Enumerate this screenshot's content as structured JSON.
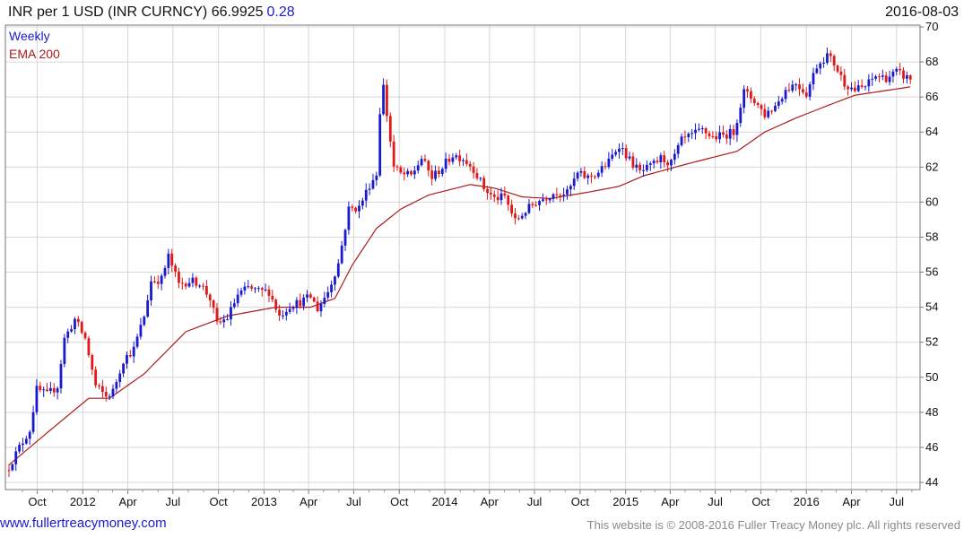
{
  "header": {
    "title": "INR per 1 USD (INR CURNCY) 66.9925",
    "change": "0.28",
    "date": "2016-08-03"
  },
  "chart_data": {
    "type": "candlestick",
    "frequency_label": "Weekly",
    "indicator_label": "EMA 200",
    "ylim": [
      44,
      70
    ],
    "y_ticks": [
      44,
      46,
      48,
      50,
      52,
      54,
      56,
      58,
      60,
      62,
      64,
      66,
      68,
      70
    ],
    "x_ticks": [
      {
        "label": "Oct",
        "date": "2011-10-01"
      },
      {
        "label": "2012",
        "date": "2012-01-01"
      },
      {
        "label": "Apr",
        "date": "2012-04-01"
      },
      {
        "label": "Jul",
        "date": "2012-07-01"
      },
      {
        "label": "Oct",
        "date": "2012-10-01"
      },
      {
        "label": "2013",
        "date": "2013-01-01"
      },
      {
        "label": "Apr",
        "date": "2013-04-01"
      },
      {
        "label": "Jul",
        "date": "2013-07-01"
      },
      {
        "label": "Oct",
        "date": "2013-10-01"
      },
      {
        "label": "2014",
        "date": "2014-01-01"
      },
      {
        "label": "Apr",
        "date": "2014-04-01"
      },
      {
        "label": "Jul",
        "date": "2014-07-01"
      },
      {
        "label": "Oct",
        "date": "2014-10-01"
      },
      {
        "label": "2015",
        "date": "2015-01-01"
      },
      {
        "label": "Apr",
        "date": "2015-04-01"
      },
      {
        "label": "Jul",
        "date": "2015-07-01"
      },
      {
        "label": "Oct",
        "date": "2015-10-01"
      },
      {
        "label": "2016",
        "date": "2016-01-01"
      },
      {
        "label": "Apr",
        "date": "2016-04-01"
      },
      {
        "label": "Jul",
        "date": "2016-07-01"
      }
    ],
    "close_path": [
      [
        "2011-08-05",
        44.9
      ],
      [
        "2011-08-26",
        46.0
      ],
      [
        "2011-09-16",
        47.0
      ],
      [
        "2011-09-30",
        49.3
      ],
      [
        "2011-10-21",
        49.0
      ],
      [
        "2011-11-11",
        49.5
      ],
      [
        "2011-11-25",
        52.2
      ],
      [
        "2011-12-16",
        53.3
      ],
      [
        "2012-01-06",
        52.2
      ],
      [
        "2012-01-27",
        49.5
      ],
      [
        "2012-02-17",
        48.9
      ],
      [
        "2012-03-02",
        49.2
      ],
      [
        "2012-03-23",
        51.0
      ],
      [
        "2012-04-13",
        51.6
      ],
      [
        "2012-05-04",
        53.5
      ],
      [
        "2012-05-18",
        55.5
      ],
      [
        "2012-06-08",
        55.6
      ],
      [
        "2012-06-22",
        56.9
      ],
      [
        "2012-07-13",
        55.3
      ],
      [
        "2012-08-03",
        55.5
      ],
      [
        "2012-08-24",
        55.4
      ],
      [
        "2012-09-14",
        54.5
      ],
      [
        "2012-09-28",
        53.0
      ],
      [
        "2012-10-19",
        53.4
      ],
      [
        "2012-11-09",
        54.7
      ],
      [
        "2012-11-30",
        55.1
      ],
      [
        "2012-12-21",
        54.9
      ],
      [
        "2013-01-11",
        54.9
      ],
      [
        "2013-02-01",
        53.5
      ],
      [
        "2013-02-22",
        54.1
      ],
      [
        "2013-03-15",
        54.3
      ],
      [
        "2013-04-05",
        54.6
      ],
      [
        "2013-04-19",
        53.9
      ],
      [
        "2013-05-10",
        54.9
      ],
      [
        "2013-05-31",
        56.5
      ],
      [
        "2013-06-21",
        59.6
      ],
      [
        "2013-07-12",
        59.7
      ],
      [
        "2013-08-02",
        61.0
      ],
      [
        "2013-08-16",
        61.6
      ],
      [
        "2013-08-23",
        65.2
      ],
      [
        "2013-08-30",
        66.6
      ],
      [
        "2013-09-06",
        65.0
      ],
      [
        "2013-09-20",
        62.0
      ],
      [
        "2013-10-04",
        61.6
      ],
      [
        "2013-10-25",
        61.5
      ],
      [
        "2013-11-15",
        62.5
      ],
      [
        "2013-12-06",
        61.4
      ],
      [
        "2013-12-27",
        62.0
      ],
      [
        "2014-01-17",
        62.7
      ],
      [
        "2014-02-07",
        62.5
      ],
      [
        "2014-02-28",
        61.9
      ],
      [
        "2014-03-21",
        60.8
      ],
      [
        "2014-04-11",
        60.2
      ],
      [
        "2014-05-02",
        60.3
      ],
      [
        "2014-05-23",
        58.9
      ],
      [
        "2014-06-13",
        59.5
      ],
      [
        "2014-07-04",
        60.0
      ],
      [
        "2014-07-25",
        60.3
      ],
      [
        "2014-08-15",
        60.6
      ],
      [
        "2014-09-05",
        60.5
      ],
      [
        "2014-09-26",
        61.6
      ],
      [
        "2014-10-17",
        61.4
      ],
      [
        "2014-11-07",
        61.7
      ],
      [
        "2014-11-28",
        62.3
      ],
      [
        "2014-12-19",
        63.3
      ],
      [
        "2015-01-09",
        62.4
      ],
      [
        "2015-01-30",
        61.7
      ],
      [
        "2015-02-20",
        62.0
      ],
      [
        "2015-03-13",
        62.5
      ],
      [
        "2015-04-03",
        62.2
      ],
      [
        "2015-04-24",
        63.5
      ],
      [
        "2015-05-15",
        63.8
      ],
      [
        "2015-06-05",
        64.1
      ],
      [
        "2015-06-26",
        63.7
      ],
      [
        "2015-07-17",
        63.8
      ],
      [
        "2015-08-07",
        64.0
      ],
      [
        "2015-08-28",
        66.3
      ],
      [
        "2015-09-18",
        65.8
      ],
      [
        "2015-10-09",
        65.0
      ],
      [
        "2015-10-30",
        65.5
      ],
      [
        "2015-11-20",
        66.4
      ],
      [
        "2015-12-11",
        66.8
      ],
      [
        "2016-01-01",
        66.2
      ],
      [
        "2016-01-22",
        67.8
      ],
      [
        "2016-02-12",
        68.4
      ],
      [
        "2016-02-26",
        67.9
      ],
      [
        "2016-03-18",
        66.8
      ],
      [
        "2016-04-08",
        66.4
      ],
      [
        "2016-04-29",
        66.6
      ],
      [
        "2016-05-20",
        67.2
      ],
      [
        "2016-06-10",
        67.1
      ],
      [
        "2016-07-01",
        67.4
      ],
      [
        "2016-07-22",
        67.1
      ],
      [
        "2016-08-03",
        66.99
      ]
    ],
    "ema_path": [
      [
        "2011-08-05",
        45.0
      ],
      [
        "2011-10-28",
        47.0
      ],
      [
        "2012-01-13",
        48.8
      ],
      [
        "2012-02-24",
        48.8
      ],
      [
        "2012-05-04",
        50.2
      ],
      [
        "2012-07-27",
        52.6
      ],
      [
        "2012-10-19",
        53.5
      ],
      [
        "2013-01-25",
        54.0
      ],
      [
        "2013-04-05",
        54.0
      ],
      [
        "2013-05-24",
        54.5
      ],
      [
        "2013-06-28",
        56.4
      ],
      [
        "2013-08-16",
        58.5
      ],
      [
        "2013-10-04",
        59.6
      ],
      [
        "2013-11-29",
        60.4
      ],
      [
        "2014-02-21",
        61.0
      ],
      [
        "2014-04-11",
        60.8
      ],
      [
        "2014-06-06",
        60.3
      ],
      [
        "2014-08-01",
        60.2
      ],
      [
        "2014-10-24",
        60.6
      ],
      [
        "2014-12-19",
        60.9
      ],
      [
        "2015-02-06",
        61.5
      ],
      [
        "2015-05-08",
        62.2
      ],
      [
        "2015-08-14",
        62.9
      ],
      [
        "2015-10-09",
        64.0
      ],
      [
        "2015-12-11",
        64.8
      ],
      [
        "2016-02-12",
        65.5
      ],
      [
        "2016-04-08",
        66.1
      ],
      [
        "2016-08-03",
        66.6
      ]
    ],
    "series": [
      {
        "name": "INR per 1 USD",
        "colors": {
          "up": "#1a1acc",
          "down": "#e01818"
        }
      },
      {
        "name": "EMA 200",
        "color": "#aa1a1a"
      }
    ],
    "grid": true
  },
  "footer": {
    "url": "www.fullertreacymoney.com",
    "copyright": "This website is © 2008-2016 Fuller Treacy Money plc. All rights reserved"
  }
}
